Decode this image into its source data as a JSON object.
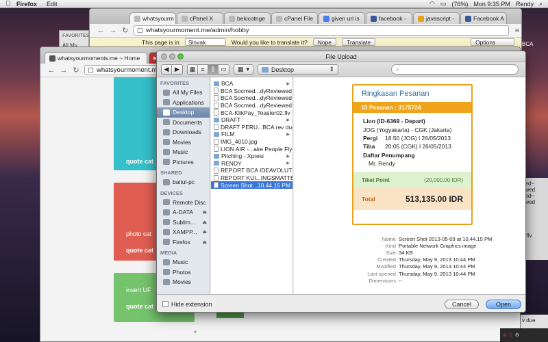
{
  "menubar": {
    "app": "Firefox",
    "items": [
      "Edit"
    ],
    "battery": "(76%)",
    "clock": "Mon 9:35 PM",
    "user": "Rendy"
  },
  "back_browser": {
    "tabs": [
      "whatsyourm",
      "cPanel X",
      "bekicotnge",
      "cPanel File",
      "given url is",
      "facebook -",
      "javascript -",
      "Facebook A"
    ],
    "url": "whatsyourmoment.me/admin/hobby",
    "favorites_label": "FAVORITES",
    "bookmark_label": "All My",
    "translate": {
      "message": "This page is in",
      "language": "Slovak",
      "question": "Would you like to translate it?",
      "nope": "Nope",
      "translate": "Translate",
      "options": "Options"
    }
  },
  "front_browser": {
    "tab_title": "whatsyourmoments.me ~ Home",
    "url": "whatsyourmoment.me/#back",
    "cards": [
      {
        "label": "quote cat",
        "color": "#35bfc9"
      },
      {
        "label": "photo cat",
        "color": "#e05d52"
      },
      {
        "label": "quote cat",
        "color": "#e05d52"
      },
      {
        "label": "insert UF",
        "color": "#75c36c"
      },
      {
        "label": "quote cat",
        "color": "#75c36c"
      }
    ]
  },
  "dialog": {
    "title": "File Upload",
    "location": "Desktop",
    "sidebar": {
      "favorites_header": "FAVORITES",
      "favorites": [
        "All My Files",
        "Applications",
        "Desktop",
        "Documents",
        "Downloads",
        "Movies",
        "Music",
        "Pictures"
      ],
      "shared_header": "SHARED",
      "shared": [
        "baitul-pc"
      ],
      "devices_header": "DEVICES",
      "devices": [
        "Remote Disc",
        "A-DATA",
        "Sublim...",
        "XAMPP...",
        "Firefox"
      ],
      "media_header": "MEDIA",
      "media": [
        "Music",
        "Photos",
        "Movies"
      ],
      "selected": "Desktop"
    },
    "files": [
      {
        "name": "BCA",
        "folder": true
      },
      {
        "name": "BCA Socmed...dyReviewed",
        "folder": false
      },
      {
        "name": "BCA Socmed...dyReviewed",
        "folder": false
      },
      {
        "name": "BCA Socmed...dyReviewed",
        "folder": false
      },
      {
        "name": "BCA-KlikPay_Toaster02.flv",
        "folder": false
      },
      {
        "name": "DRAFT",
        "folder": true
      },
      {
        "name": "DRAFT PERU...BCA rev due",
        "folder": false
      },
      {
        "name": "FILM",
        "folder": true
      },
      {
        "name": "IMG_4010.jpg",
        "folder": false
      },
      {
        "name": "LION AIR -...ake People Fly",
        "folder": false
      },
      {
        "name": "Pitching - Xpresi",
        "folder": true
      },
      {
        "name": "RENDY",
        "folder": true
      },
      {
        "name": "REPORT BCA IDEAVOLUTION",
        "folder": false
      },
      {
        "name": "REPORT KUI...INGSMATTER",
        "folder": false
      },
      {
        "name": "Screen Shot...10.44.15 PM",
        "folder": false
      }
    ],
    "selected_file": "Screen Shot...10.44.15 PM",
    "receipt": {
      "heading": "Ringkasan Pesanan",
      "id_line": "ID Pesanan : 3175724",
      "flight": "Lion (ID-6369 - Depart)",
      "route": "JOG (Yogyakarta) - CGK (Jakarta)",
      "pergi_label": "Pergi",
      "pergi_value": "18:50 (JOG) l 26/05/2013",
      "tiba_label": "Tiba",
      "tiba_value": "20:05 (CGK) l 26/05/2013",
      "passengers_label": "Daftar Penumpang",
      "passenger": "Mr. Rendy",
      "tiket_label": "Tiket Point",
      "tiket_value": "(20,000.00 IDR)",
      "total_label": "Total",
      "total_value": "513,135.00 IDR"
    },
    "metadata": [
      {
        "key": "Name",
        "value": "Screen Shot 2013-05-09 at 10.44.15 PM"
      },
      {
        "key": "Kind",
        "value": "Portable Network Graphics image"
      },
      {
        "key": "Size",
        "value": "34 KB"
      },
      {
        "key": "Created",
        "value": "Thursday, May 9, 2013 10:44 PM"
      },
      {
        "key": "Modified",
        "value": "Thursday, May 9, 2013 10:44 PM"
      },
      {
        "key": "Last opened",
        "value": "Thursday, May 9, 2013 10:44 PM"
      },
      {
        "key": "Dimensions",
        "value": "--"
      }
    ],
    "hide_extension": "Hide extension",
    "cancel": "Cancel",
    "open": "Open"
  },
  "right_edge": {
    "texts": [
      "BCA",
      "ned~",
      "ewed",
      "ned~",
      "ewed",
      "2.flv",
      "v due"
    ],
    "badge": "1"
  }
}
